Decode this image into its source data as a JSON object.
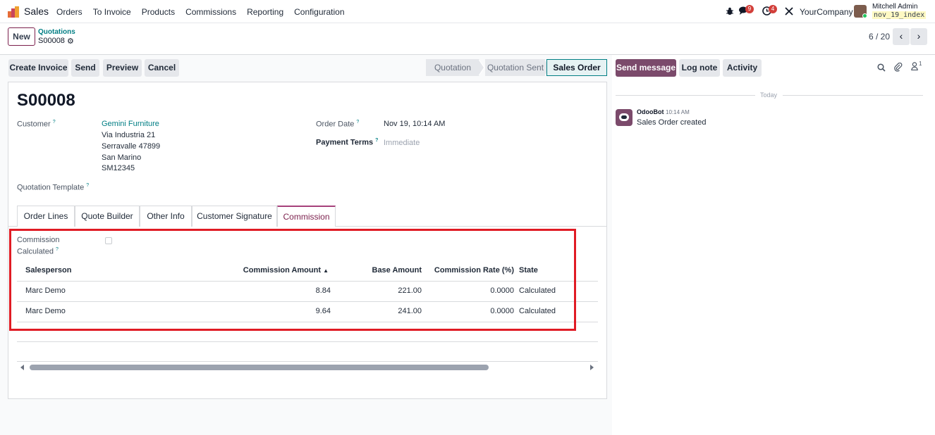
{
  "navbar": {
    "app_name": "Sales",
    "menu": [
      "Orders",
      "To Invoice",
      "Products",
      "Commissions",
      "Reporting",
      "Configuration"
    ],
    "messages_count": "9",
    "activities_count": "4",
    "company": "YourCompany",
    "user_name": "Mitchell Admin",
    "database": "nov_19_index"
  },
  "control_panel": {
    "new_label": "New",
    "breadcrumb_parent": "Quotations",
    "breadcrumb_current": "S00008",
    "pager": "6 / 20"
  },
  "actions": {
    "create_invoice": "Create Invoice",
    "send": "Send",
    "preview": "Preview",
    "cancel": "Cancel"
  },
  "statusbar": {
    "steps": [
      "Quotation",
      "Quotation Sent",
      "Sales Order"
    ],
    "active": "Sales Order"
  },
  "form": {
    "title": "S00008",
    "customer_label": "Customer",
    "customer_name": "Gemini Furniture",
    "address": [
      "Via Industria 21",
      "Serravalle 47899",
      "San Marino",
      "SM12345"
    ],
    "order_date_label": "Order Date",
    "order_date": "Nov 19, 10:14 AM",
    "payment_terms_label": "Payment Terms",
    "payment_terms_placeholder": "Immediate",
    "quotation_template_label": "Quotation Template",
    "help_mark": "?"
  },
  "tabs": [
    "Order Lines",
    "Quote Builder",
    "Other Info",
    "Customer Signature",
    "Commission"
  ],
  "commission": {
    "calculated_label_line1": "Commission",
    "calculated_label_line2": "Calculated",
    "calculated": false,
    "columns": [
      "Salesperson",
      "Commission Amount",
      "Base Amount",
      "Commission Rate (%)",
      "State"
    ],
    "sort_indicator": "▲",
    "rows": [
      {
        "salesperson": "Marc Demo",
        "commission_amount": "8.84",
        "base_amount": "221.00",
        "rate": "0.0000",
        "state": "Calculated"
      },
      {
        "salesperson": "Marc Demo",
        "commission_amount": "9.64",
        "base_amount": "241.00",
        "rate": "0.0000",
        "state": "Calculated"
      }
    ]
  },
  "chatter": {
    "send_message": "Send message",
    "log_note": "Log note",
    "activity": "Activity",
    "followers_count": "1",
    "today": "Today",
    "message_author": "OdooBot",
    "message_time": "10:14 AM",
    "message_body": "Sales Order created"
  },
  "colors": {
    "brand": "#7b4a6b",
    "link": "#017e84",
    "highlight": "#e01b24",
    "badge": "#d23f3a"
  }
}
